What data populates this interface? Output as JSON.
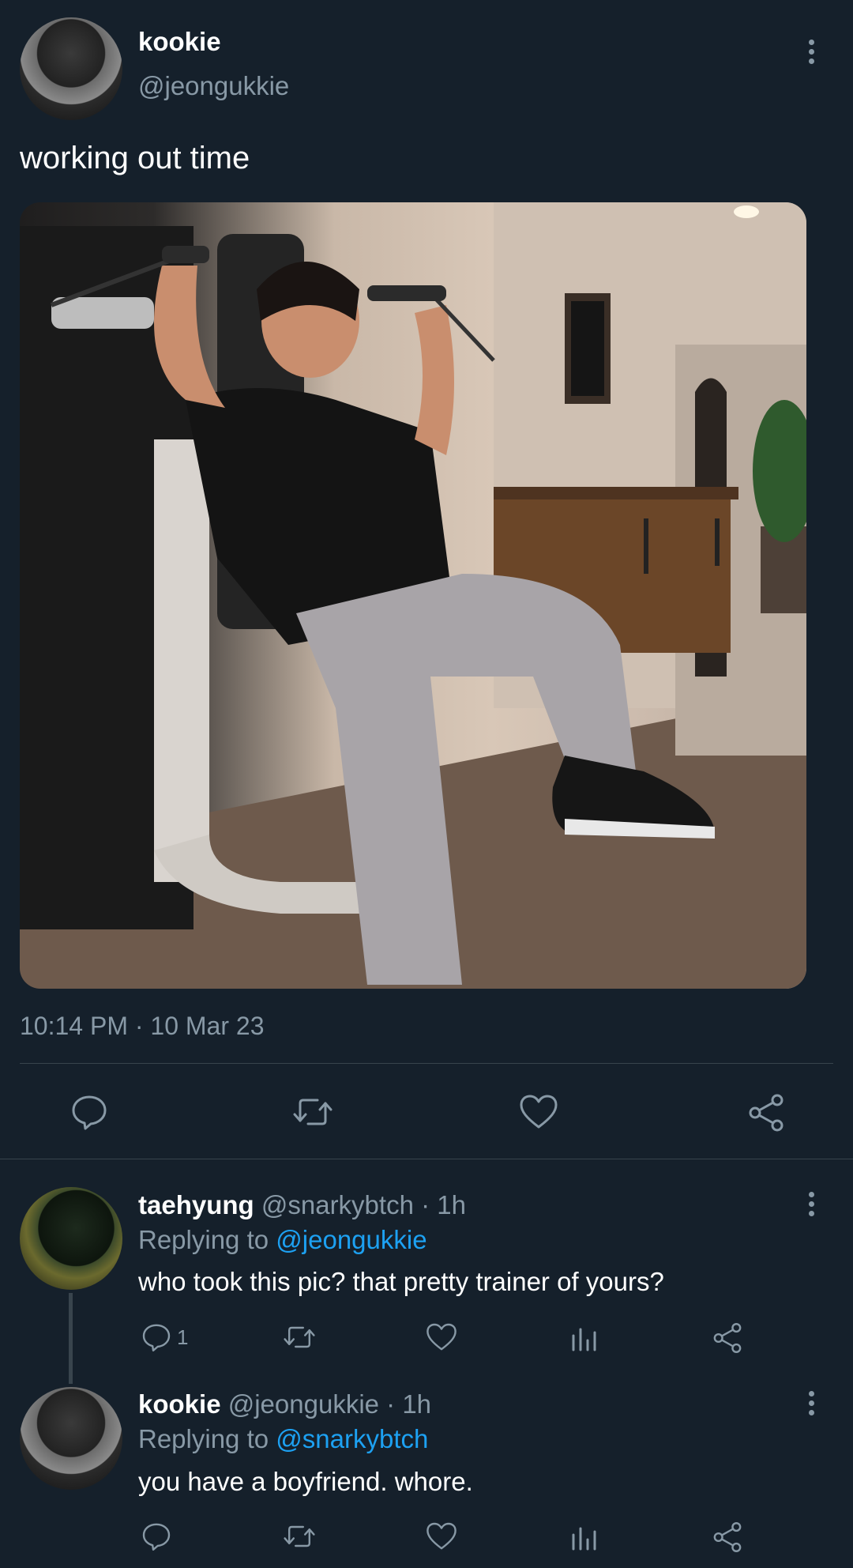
{
  "tweet": {
    "display_name": "kookie",
    "handle": "@jeongukkie",
    "text": "working out time",
    "timestamp": "10:14 PM · 10 Mar 23",
    "image_alt": "person seated on a cable gym machine"
  },
  "replies": [
    {
      "display_name": "taehyung",
      "handle": "@snarkybtch",
      "time": "· 1h",
      "replying_prefix": "Replying to",
      "replying_to": "@jeongukkie",
      "text": "who took this pic? that pretty trainer of yours?",
      "reply_count": "1"
    },
    {
      "display_name": "kookie",
      "handle": "@jeongukkie",
      "time": "· 1h",
      "replying_prefix": "Replying to",
      "replying_to": "@snarkybtch",
      "text": "you have a boyfriend. whore.",
      "reply_count": ""
    }
  ],
  "icons": {
    "reply": "speech-bubble-icon",
    "retweet": "retweet-arrows-icon",
    "like": "heart-icon",
    "share": "share-nodes-icon",
    "analytics": "bar-chart-icon",
    "more": "vertical-dots-icon"
  },
  "colors": {
    "background": "#15202b",
    "muted_text": "#8899a6",
    "link": "#1da1f2",
    "divider": "#38444d"
  }
}
